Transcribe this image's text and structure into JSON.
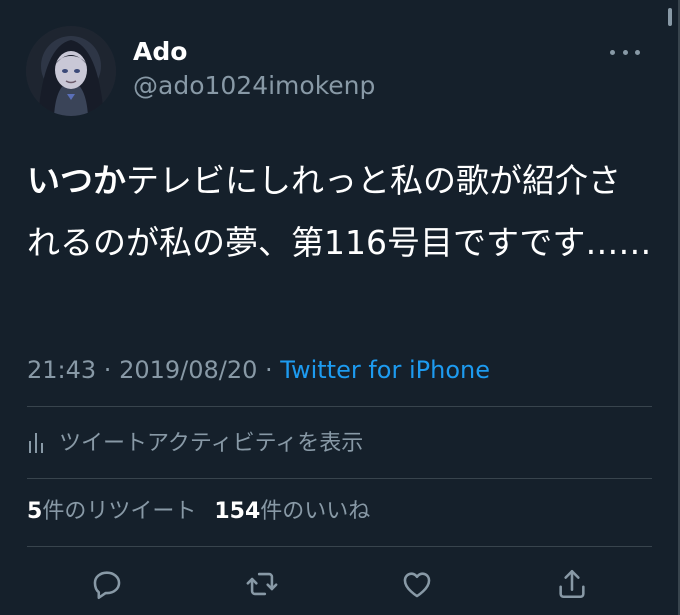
{
  "user": {
    "display_name": "Ado",
    "handle": "@ado1024imokenp"
  },
  "tweet": {
    "bold_text": "いつか",
    "text": "テレビにしれっと私の歌が紹介されるのが私の夢、第116号目ですです……"
  },
  "meta": {
    "time": "21:43",
    "separator": " · ",
    "date": "2019/08/20",
    "source": "Twitter for iPhone"
  },
  "activity": {
    "label": "ツイートアクティビティを表示"
  },
  "stats": {
    "retweets_count": "5",
    "retweets_label": "件のリツイート",
    "likes_count": "154",
    "likes_label": "件のいいね"
  },
  "icons": {
    "reply": "reply-icon",
    "retweet": "retweet-icon",
    "like": "like-icon",
    "share": "share-icon",
    "activity": "bar-chart-icon",
    "more": "more-horizontal-icon"
  },
  "colors": {
    "background": "#15202b",
    "secondary_text": "#8899a6",
    "link": "#1d9bf0",
    "divider": "#38444d"
  }
}
